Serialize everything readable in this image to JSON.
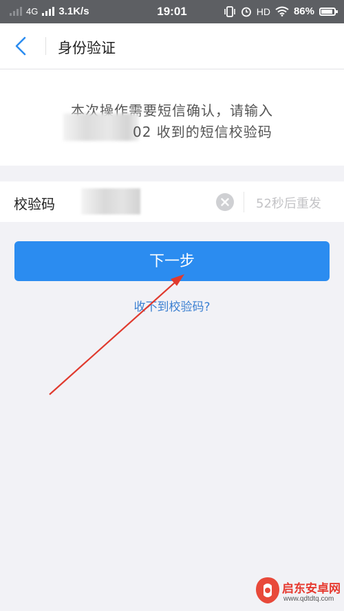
{
  "status_bar": {
    "network": "4G",
    "speed": "3.1K/s",
    "time": "19:01",
    "hd": "HD",
    "battery": "86%"
  },
  "header": {
    "title": "身份验证"
  },
  "info": {
    "line1": "本次操作需要短信确认，请输入",
    "line2": "02 收到的短信校验码"
  },
  "code_row": {
    "label": "校验码",
    "resend": "52秒后重发"
  },
  "actions": {
    "next_label": "下一步",
    "help_link": "收不到校验码?"
  },
  "colors": {
    "accent": "#2b8cf0",
    "link": "#3a7fd1",
    "annotation": "#e03a2e"
  },
  "watermark": {
    "name": "启东安卓网",
    "url": "www.qdtdtq.com"
  }
}
